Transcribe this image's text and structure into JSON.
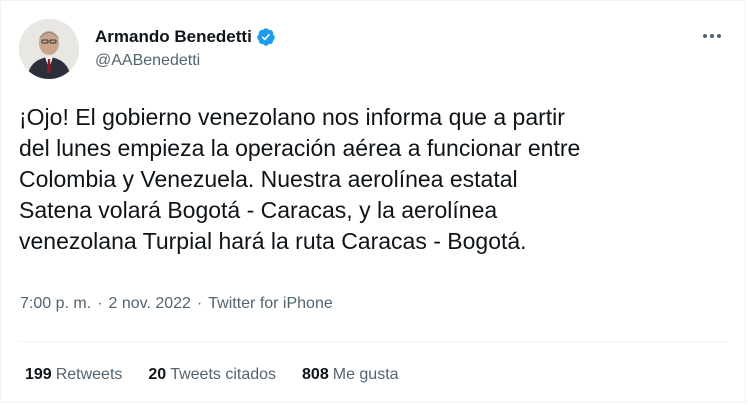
{
  "author": {
    "display_name": "Armando Benedetti",
    "handle": "@AABenedetti",
    "avatar_icon": "profile-photo",
    "verified_icon": "verified-badge-icon"
  },
  "tweet": {
    "text": "¡Ojo! El gobierno venezolano nos informa que a partir\ndel lunes empieza la operación aérea a funcionar entre\nColombia y Venezuela. Nuestra aerolínea estatal\nSatena volará Bogotá - Caracas, y la aerolínea\nvenezolana Turpial hará la ruta Caracas - Bogotá."
  },
  "meta": {
    "time": "7:00 p. m.",
    "separator": "·",
    "date": "2 nov. 2022",
    "source": "Twitter for iPhone"
  },
  "stats": {
    "retweets_count": "199",
    "retweets_label": "Retweets",
    "quotes_count": "20",
    "quotes_label": "Tweets citados",
    "likes_count": "808",
    "likes_label": "Me gusta"
  },
  "colors": {
    "text_primary": "#0f1419",
    "text_secondary": "#536471",
    "verified_blue": "#1d9bf0",
    "border": "#eff3f4"
  },
  "more_icon": "more-dots-icon"
}
